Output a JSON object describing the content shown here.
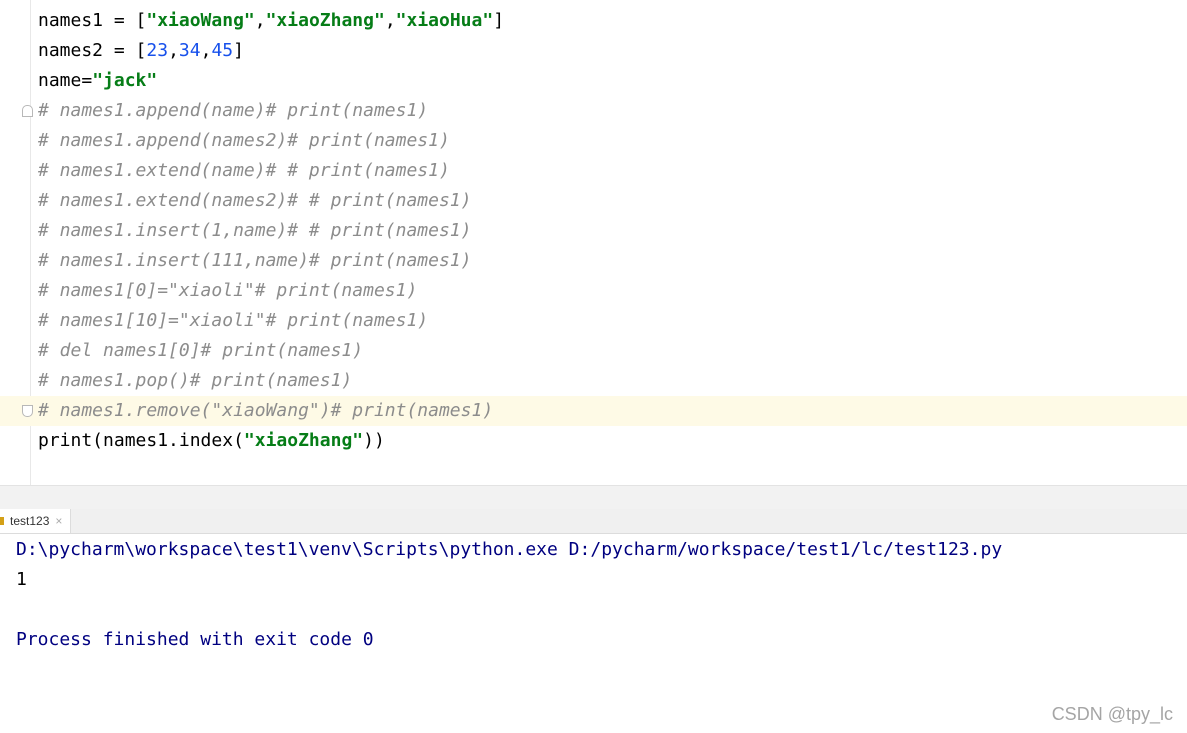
{
  "editor": {
    "lines": [
      {
        "parts": [
          {
            "t": "names1 = [",
            "c": ""
          },
          {
            "t": "\"xiaoWang\"",
            "c": "str"
          },
          {
            "t": ",",
            "c": ""
          },
          {
            "t": "\"xiaoZhang\"",
            "c": "str"
          },
          {
            "t": ",",
            "c": ""
          },
          {
            "t": "\"xiaoHua\"",
            "c": "str"
          },
          {
            "t": "]",
            "c": ""
          }
        ]
      },
      {
        "parts": [
          {
            "t": "names2 = [",
            "c": ""
          },
          {
            "t": "23",
            "c": "num"
          },
          {
            "t": ",",
            "c": ""
          },
          {
            "t": "34",
            "c": "num"
          },
          {
            "t": ",",
            "c": ""
          },
          {
            "t": "45",
            "c": "num"
          },
          {
            "t": "]",
            "c": ""
          }
        ]
      },
      {
        "parts": [
          {
            "t": "name=",
            "c": ""
          },
          {
            "t": "\"jack\"",
            "c": "str"
          }
        ]
      },
      {
        "fold": "down",
        "parts": [
          {
            "t": "# names1.append(name)# print(names1)",
            "c": "comment"
          }
        ]
      },
      {
        "parts": [
          {
            "t": "# names1.append(names2)# print(names1)",
            "c": "comment"
          }
        ]
      },
      {
        "parts": [
          {
            "t": "# names1.extend(name)# # print(names1)",
            "c": "comment"
          }
        ]
      },
      {
        "parts": [
          {
            "t": "# names1.extend(names2)# # print(names1)",
            "c": "comment"
          }
        ]
      },
      {
        "parts": [
          {
            "t": "# names1.insert(1,name)# # print(names1)",
            "c": "comment"
          }
        ]
      },
      {
        "parts": [
          {
            "t": "# names1.insert(111,name)# print(names1)",
            "c": "comment"
          }
        ]
      },
      {
        "parts": [
          {
            "t": "# names1[0]=\"xiaoli\"# print(names1)",
            "c": "comment"
          }
        ]
      },
      {
        "parts": [
          {
            "t": "# names1[10]=\"xiaoli\"# print(names1)",
            "c": "comment"
          }
        ]
      },
      {
        "parts": [
          {
            "t": "# del names1[0]# print(names1)",
            "c": "comment"
          }
        ]
      },
      {
        "parts": [
          {
            "t": "# names1.pop()# print(names1)",
            "c": "comment"
          }
        ]
      },
      {
        "fold": "up",
        "active": true,
        "parts": [
          {
            "t": "# names1.remove(\"xiaoWang\")# print(names1)",
            "c": "comment"
          }
        ]
      },
      {
        "parts": [
          {
            "t": "print(names1.index(",
            "c": ""
          },
          {
            "t": "\"xiaoZhang\"",
            "c": "str"
          },
          {
            "t": "))",
            "c": ""
          }
        ]
      }
    ]
  },
  "run": {
    "tab_label": "test123",
    "close_glyph": "×",
    "command": "D:\\pycharm\\workspace\\test1\\venv\\Scripts\\python.exe D:/pycharm/workspace/test1/lc/test123.py",
    "output": "1",
    "exit_message": "Process finished with exit code 0"
  },
  "watermark": "CSDN @tpy_lc",
  "colors": {
    "string": "#067d17",
    "number": "#1750eb",
    "comment": "#8c8c8c",
    "console_command": "#000080",
    "active_line": "#fefae6"
  },
  "icons": {
    "fold": "fold-marker-icon",
    "run_tab": "python-file-icon",
    "close": "close-icon"
  }
}
